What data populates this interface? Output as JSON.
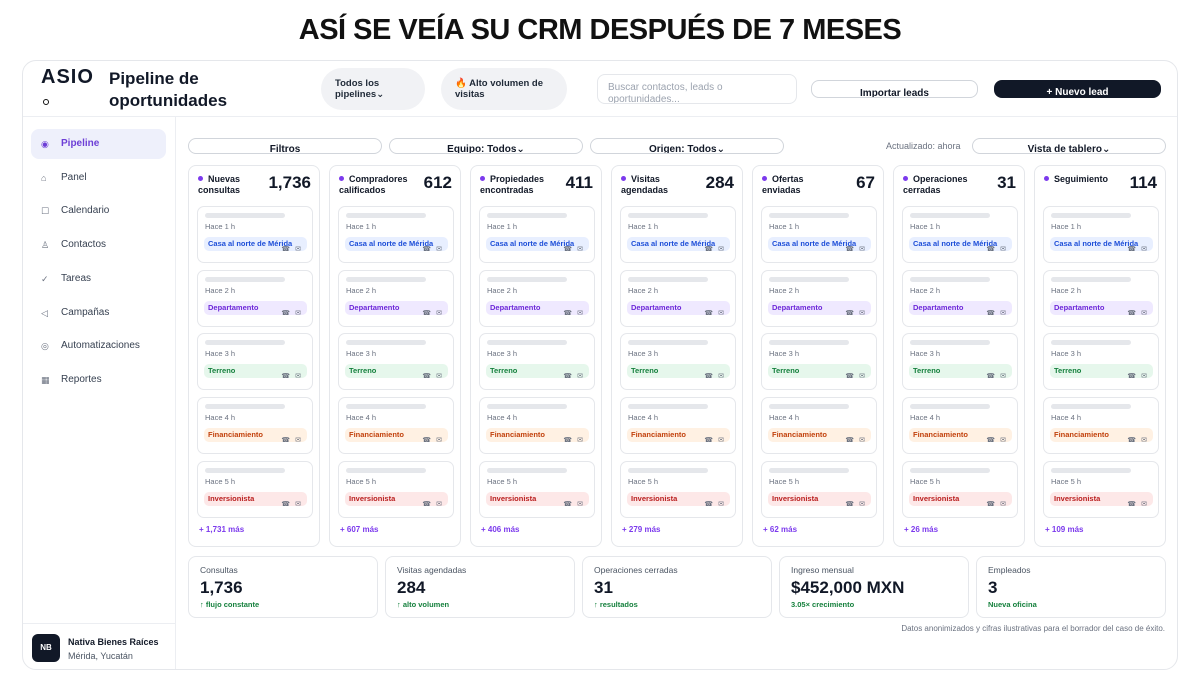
{
  "headline": "ASÍ SE VEÍA SU CRM DESPUÉS DE 7 MESES",
  "app": {
    "logo": "ASIO",
    "page_title": "Pipeline de oportunidades"
  },
  "header": {
    "pipeline_select": "Todos los pipelines",
    "volume_badge": "🔥 Alto volumen de visitas",
    "search_placeholder": "Buscar contactos, leads o oportunidades...",
    "import_label": "Importar leads",
    "new_lead_label": "+ Nuevo lead"
  },
  "sidebar": {
    "items": [
      {
        "label": "Pipeline",
        "icon": "◉",
        "icon_name": "pipeline-icon",
        "active": true
      },
      {
        "label": "Panel",
        "icon": "⌂",
        "icon_name": "home-icon",
        "active": false
      },
      {
        "label": "Calendario",
        "icon": "☐",
        "icon_name": "calendar-icon",
        "active": false
      },
      {
        "label": "Contactos",
        "icon": "♙",
        "icon_name": "contacts-icon",
        "active": false
      },
      {
        "label": "Tareas",
        "icon": "✓",
        "icon_name": "tasks-icon",
        "active": false
      },
      {
        "label": "Campañas",
        "icon": "◁",
        "icon_name": "campaigns-icon",
        "active": false
      },
      {
        "label": "Automatizaciones",
        "icon": "◎",
        "icon_name": "automation-icon",
        "active": false
      },
      {
        "label": "Reportes",
        "icon": "▦",
        "icon_name": "reports-icon",
        "active": false
      }
    ],
    "org": {
      "initials": "NB",
      "name": "Nativa Bienes Raíces",
      "location": "Mérida, Yucatán"
    }
  },
  "filters": {
    "filters_label": "Filtros",
    "team": "Equipo: Todos",
    "origin": "Origen: Todos",
    "updated": "Actualizado: ahora",
    "view": "Vista de tablero"
  },
  "columns": [
    {
      "name": "Nuevas consultas",
      "count": "1,736",
      "more": "+ 1,731 más"
    },
    {
      "name": "Compradores calificados",
      "count": "612",
      "more": "+ 607 más"
    },
    {
      "name": "Propiedades encontradas",
      "count": "411",
      "more": "+ 406 más"
    },
    {
      "name": "Visitas agendadas",
      "count": "284",
      "more": "+ 279 más"
    },
    {
      "name": "Ofertas enviadas",
      "count": "67",
      "more": "+ 62 más"
    },
    {
      "name": "Operaciones cerradas",
      "count": "31",
      "more": "+ 26 más"
    },
    {
      "name": "Seguimiento",
      "count": "114",
      "more": "+ 109 más"
    }
  ],
  "card_template": [
    {
      "time": "Hace 1 h",
      "tag": "Casa al norte de Mérida",
      "tag_style": "blue"
    },
    {
      "time": "Hace 2 h",
      "tag": "Departamento",
      "tag_style": "purple"
    },
    {
      "time": "Hace 3 h",
      "tag": "Terreno",
      "tag_style": "green"
    },
    {
      "time": "Hace 4 h",
      "tag": "Financiamiento",
      "tag_style": "orange"
    },
    {
      "time": "Hace 5 h",
      "tag": "Inversionista",
      "tag_style": "red"
    }
  ],
  "card_icons": {
    "phone": "☎",
    "mail": "✉"
  },
  "stats": [
    {
      "label": "Consultas",
      "value": "1,736",
      "note": "↑ flujo constante"
    },
    {
      "label": "Visitas agendadas",
      "value": "284",
      "note": "↑ alto volumen"
    },
    {
      "label": "Operaciones cerradas",
      "value": "31",
      "note": "↑ resultados"
    },
    {
      "label": "Ingreso mensual",
      "value": "$452,000 MXN",
      "note": "3.05× crecimiento"
    },
    {
      "label": "Empleados",
      "value": "3",
      "note": "Nueva oficina"
    }
  ],
  "footnote": "Datos anonimizados y cifras ilustrativas para el borrador del caso de éxito."
}
